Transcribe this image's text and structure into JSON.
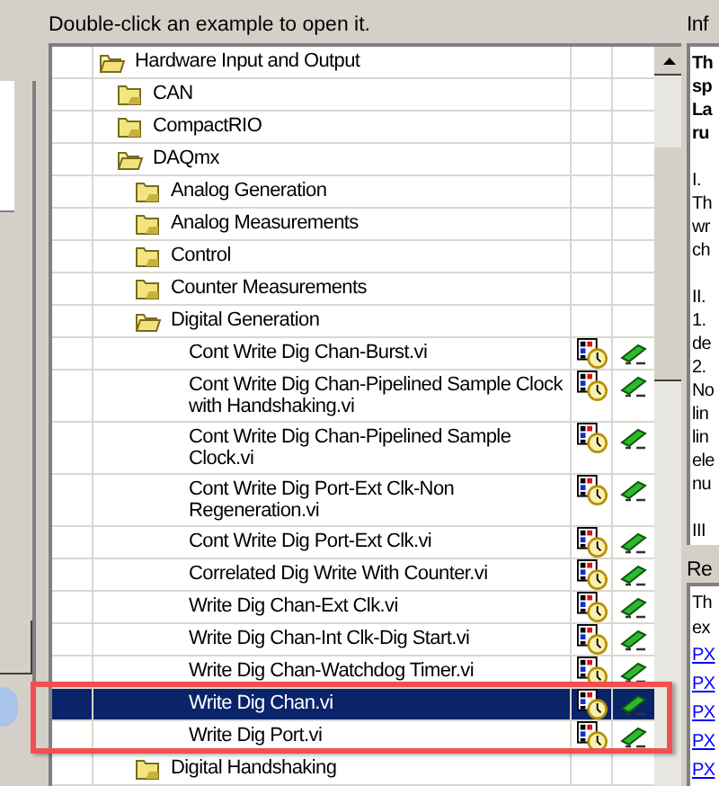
{
  "hint": "Double-click an example to open it.",
  "tree": [
    {
      "label": "Hardware Input and Output",
      "kind": "folder",
      "expanded": true,
      "selected": false,
      "children": [
        {
          "label": "CAN",
          "kind": "folder",
          "expanded": false,
          "selected": false
        },
        {
          "label": "CompactRIO",
          "kind": "folder",
          "expanded": false,
          "selected": false
        },
        {
          "label": "DAQmx",
          "kind": "folder",
          "expanded": true,
          "selected": false,
          "children": [
            {
              "label": "Analog Generation",
              "kind": "folder",
              "expanded": false,
              "selected": false
            },
            {
              "label": "Analog Measurements",
              "kind": "folder",
              "expanded": false,
              "selected": false
            },
            {
              "label": "Control",
              "kind": "folder",
              "expanded": false,
              "selected": false
            },
            {
              "label": "Counter Measurements",
              "kind": "folder",
              "expanded": false,
              "selected": false
            },
            {
              "label": "Digital Generation",
              "kind": "folder",
              "expanded": true,
              "selected": false,
              "children": [
                {
                  "label": "Cont Write Dig Chan-Burst.vi",
                  "kind": "vi",
                  "selected": false
                },
                {
                  "label": "Cont Write Dig Chan-Pipelined Sample Clock with Handshaking.vi",
                  "kind": "vi",
                  "selected": false
                },
                {
                  "label": "Cont Write Dig Chan-Pipelined Sample Clock.vi",
                  "kind": "vi",
                  "selected": false
                },
                {
                  "label": "Cont Write Dig Port-Ext Clk-Non Regeneration.vi",
                  "kind": "vi",
                  "selected": false
                },
                {
                  "label": "Cont Write Dig Port-Ext Clk.vi",
                  "kind": "vi",
                  "selected": false
                },
                {
                  "label": "Correlated Dig Write With Counter.vi",
                  "kind": "vi",
                  "selected": false
                },
                {
                  "label": "Write Dig Chan-Ext Clk.vi",
                  "kind": "vi",
                  "selected": false
                },
                {
                  "label": "Write Dig Chan-Int Clk-Dig Start.vi",
                  "kind": "vi",
                  "selected": false
                },
                {
                  "label": "Write Dig Chan-Watchdog Timer.vi",
                  "kind": "vi",
                  "selected": false
                },
                {
                  "label": "Write Dig Chan.vi",
                  "kind": "vi",
                  "selected": true
                },
                {
                  "label": "Write Dig Port.vi",
                  "kind": "vi",
                  "selected": false
                }
              ]
            },
            {
              "label": "Digital Handshaking",
              "kind": "folder",
              "expanded": false,
              "selected": false
            }
          ]
        }
      ]
    }
  ],
  "info": {
    "label": "Inf",
    "paragraphs": [
      {
        "bold": true,
        "lines": [
          "Th",
          "sp",
          "La",
          "ru"
        ]
      },
      {
        "bold": false,
        "lines": [
          "I.",
          "Th",
          "wr",
          "ch"
        ]
      },
      {
        "bold": false,
        "lines": [
          "II.",
          "1.",
          "de",
          "2.",
          "No",
          "lin",
          "lin",
          "ele",
          "nu"
        ]
      },
      {
        "bold": false,
        "lines": [
          "III"
        ]
      }
    ]
  },
  "requirements": {
    "label": "Re",
    "lines": [
      "Th",
      "ex"
    ],
    "links": [
      "PX",
      "PX",
      "PX",
      "PX",
      "PX"
    ]
  }
}
